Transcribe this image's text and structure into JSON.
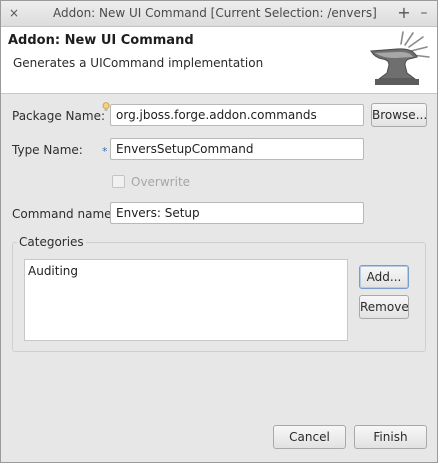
{
  "window": {
    "title": "Addon: New UI Command [Current Selection: /envers]",
    "close_glyph": "×",
    "maximize_glyph": "+",
    "minimize_glyph": "–"
  },
  "header": {
    "heading": "Addon: New UI Command",
    "description": "Generates a UICommand implementation",
    "banner_icon": "anvil-icon"
  },
  "form": {
    "package_name": {
      "label": "Package Name:",
      "value": "org.jboss.forge.addon.commands",
      "browse_label": "Browse...",
      "marker_icon": "lightbulb-icon"
    },
    "type_name": {
      "label": "Type Name:",
      "value": "EnversSetupCommand",
      "required_marker": "*"
    },
    "overwrite": {
      "label": "Overwrite",
      "checked": false,
      "enabled": false
    },
    "command_name": {
      "label": "Command name:",
      "value": "Envers: Setup"
    }
  },
  "categories": {
    "title": "Categories",
    "items": [
      "Auditing"
    ],
    "add_label": "Add...",
    "remove_label": "Remove"
  },
  "footer": {
    "cancel_label": "Cancel",
    "finish_label": "Finish"
  }
}
